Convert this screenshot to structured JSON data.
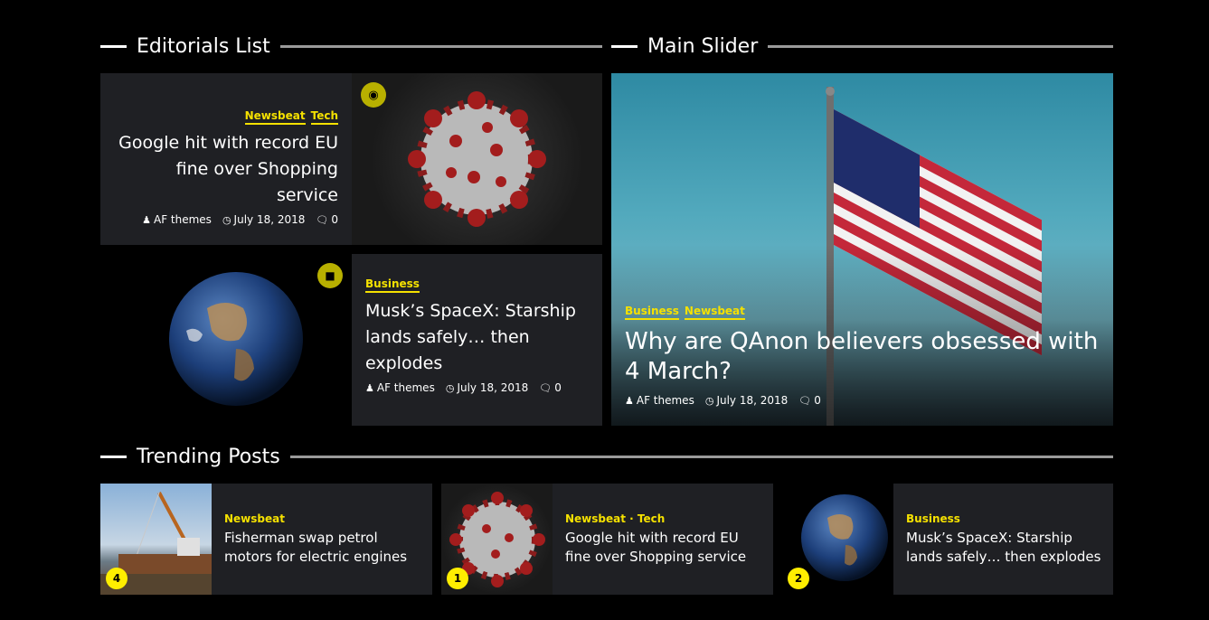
{
  "editorials": {
    "heading": "Editorials List",
    "items": [
      {
        "categories": [
          "Newsbeat",
          "Tech"
        ],
        "title": "Google hit with record EU fine over Shopping service",
        "author": "AF themes",
        "date": "July 18, 2018",
        "comments": "0",
        "media_icon": "camera-icon"
      },
      {
        "categories": [
          "Business"
        ],
        "title": "Musk’s SpaceX: Starship lands safely… then explodes",
        "author": "AF themes",
        "date": "July 18, 2018",
        "comments": "0",
        "media_icon": "video-icon"
      }
    ]
  },
  "slider": {
    "heading": "Main Slider",
    "categories": [
      "Business",
      "Newsbeat"
    ],
    "title": "Why are QAnon believers obsessed with 4 March?",
    "author": "AF themes",
    "date": "July 18, 2018",
    "comments": "0"
  },
  "trending": {
    "heading": "Trending Posts",
    "items": [
      {
        "rank": "4",
        "category": "Newsbeat",
        "title": "Fisherman swap petrol motors for electric engines"
      },
      {
        "rank": "1",
        "category": "Newsbeat · Tech",
        "title": "Google hit with record EU fine over Shopping service"
      },
      {
        "rank": "2",
        "category": "Business",
        "title": "Musk’s SpaceX: Starship lands safely… then explodes"
      }
    ]
  },
  "colors": {
    "accent": "#f5e100",
    "card_bg": "#1f2024",
    "page_bg": "#000000"
  }
}
